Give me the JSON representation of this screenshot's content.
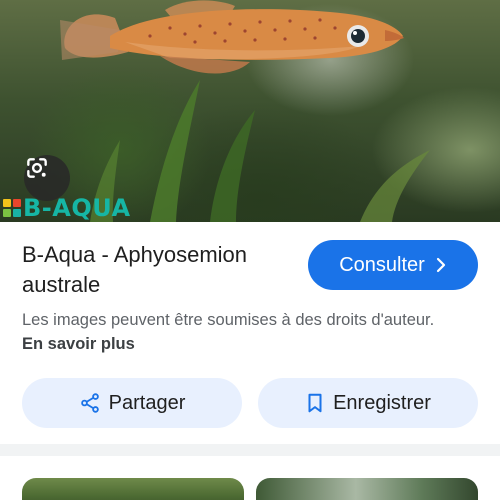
{
  "hero": {
    "image_subject": "fish",
    "watermark_text": "B-AQUA",
    "watermark_colors": [
      "#f2c21b",
      "#e8452c",
      "#7cc242",
      "#19b3a6"
    ],
    "lens_icon": "google-lens-icon"
  },
  "result": {
    "title": "B-Aqua - Aphyosemion australe",
    "consult_label": "Consulter",
    "consult_icon": "chevron-right-icon",
    "copyright_text": "Les images peuvent être soumises à des droits d'auteur.",
    "learn_more_label": "En savoir plus"
  },
  "actions": {
    "share_label": "Partager",
    "share_icon": "share-icon",
    "save_label": "Enregistrer",
    "save_icon": "bookmark-icon"
  },
  "colors": {
    "primary_button": "#1a73e8",
    "pill_background": "#e8f0fe",
    "icon_blue": "#1a73e8",
    "secondary_text": "#5f6368"
  },
  "related": {
    "thumbnails": [
      "related-image-1",
      "related-image-2"
    ]
  }
}
